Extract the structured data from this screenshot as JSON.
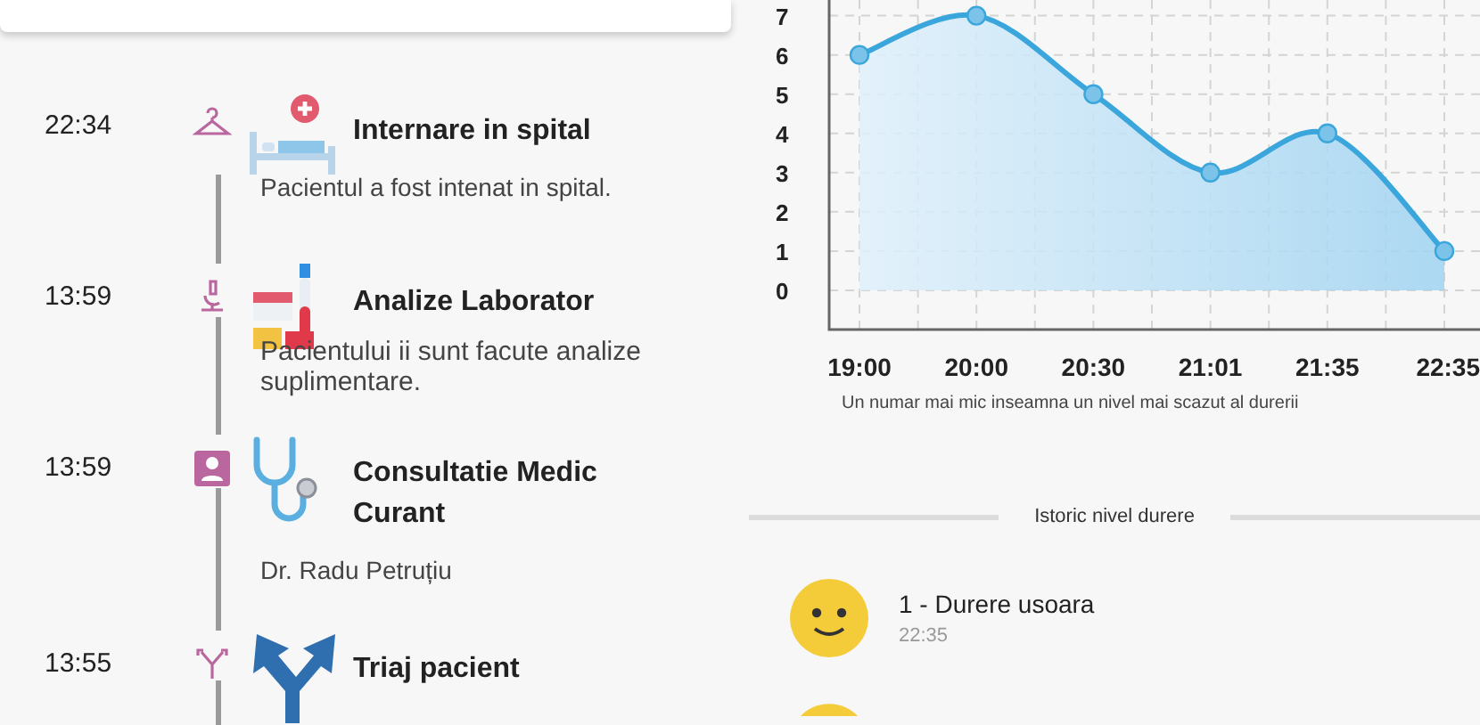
{
  "timeline": [
    {
      "time": "22:34",
      "kind": "admission",
      "title": "Internare in spital",
      "detail": "Pacientul a fost intenat in spital."
    },
    {
      "time": "13:59",
      "kind": "lab",
      "title": "Analize Laborator",
      "detail": "Pacientului ii sunt facute analize suplimentare."
    },
    {
      "time": "13:59",
      "kind": "consult",
      "title": "Consultatie Medic Curant",
      "detail": "Dr. Radu Petruțiu"
    },
    {
      "time": "13:55",
      "kind": "triage",
      "title": "Triaj pacient"
    }
  ],
  "pain_chart": {
    "chart_data": {
      "type": "area",
      "categories": [
        "19:00",
        "20:00",
        "20:30",
        "21:01",
        "21:35",
        "22:35"
      ],
      "series": [
        {
          "color": "#3aa6dc",
          "values": [
            6,
            7,
            5,
            3,
            4,
            1
          ]
        }
      ],
      "grid": true,
      "yticks": [
        0,
        1,
        2,
        3,
        4,
        5,
        6,
        7
      ],
      "ylim": [
        -1,
        7.4
      ]
    },
    "caption": "Un numar mai mic inseamna un nivel mai scazut al durerii"
  },
  "history": {
    "title": "Istoric nivel durere",
    "entries": [
      {
        "label": "1 - Durere usoara",
        "time": "22:35"
      }
    ]
  }
}
